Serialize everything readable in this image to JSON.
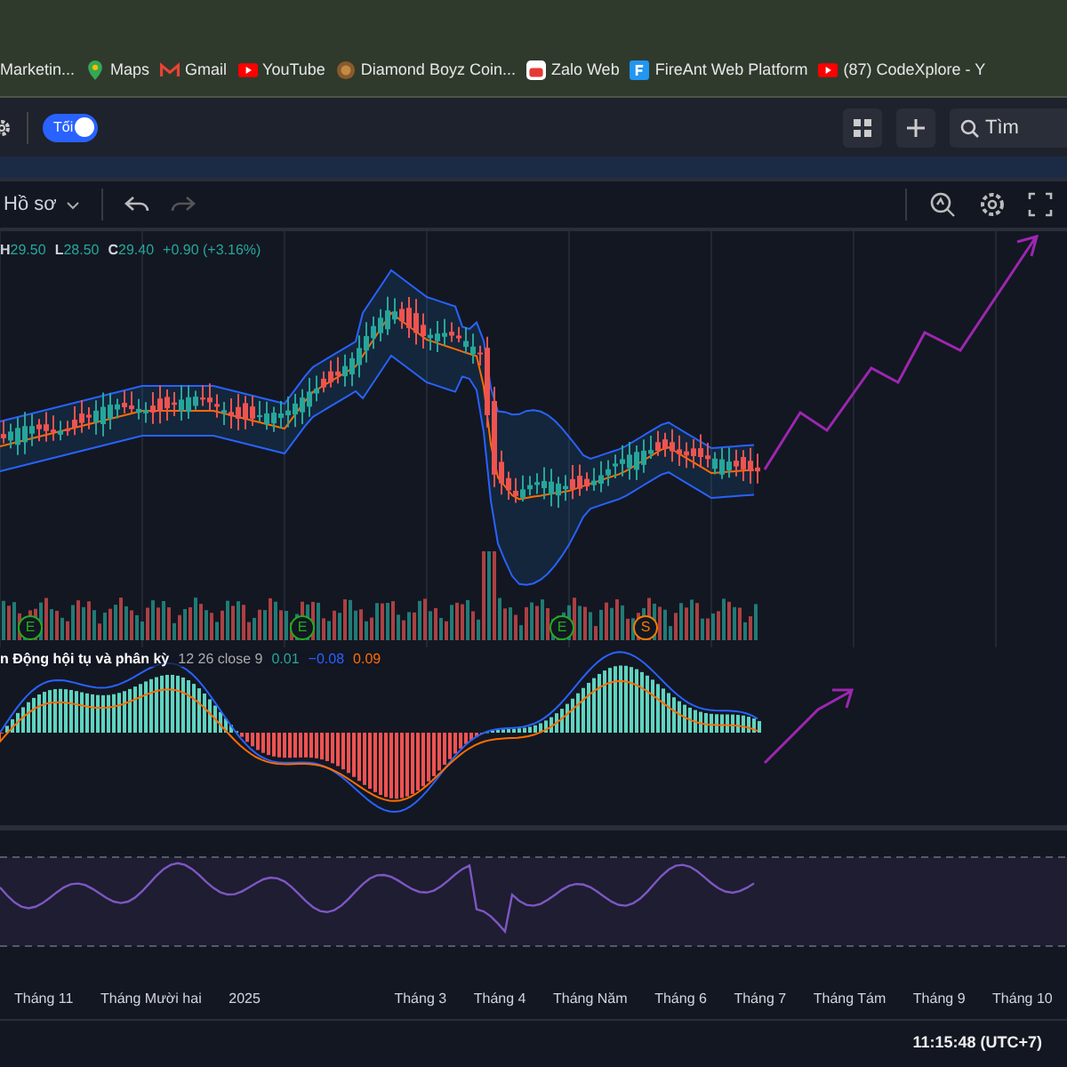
{
  "bookmarks": [
    {
      "label": "Marketin...",
      "kind": "plain"
    },
    {
      "label": "Maps",
      "kind": "pin"
    },
    {
      "label": "Gmail",
      "kind": "mail"
    },
    {
      "label": "YouTube",
      "kind": "play"
    },
    {
      "label": "Diamond Boyz Coin...",
      "kind": "coin"
    },
    {
      "label": "Zalo Web",
      "kind": "chat"
    },
    {
      "label": "FireAnt Web Platform",
      "kind": "letter"
    },
    {
      "label": "(87) CodeXplore - Y",
      "kind": "play"
    }
  ],
  "toolbar": {
    "theme_toggle": {
      "label": "Tối",
      "on": true
    },
    "search": {
      "placeholder": "Tìm"
    }
  },
  "chart_toolbar": {
    "profile": "Hồ sơ"
  },
  "legend": [
    {
      "key": "H",
      "value": "29.50"
    },
    {
      "key": "L",
      "value": "28.50"
    },
    {
      "key": "C",
      "value": "29.40"
    },
    {
      "value": "+0.90 (+3.16%)"
    }
  ],
  "events": [
    {
      "letter": "E",
      "kind": "earnings"
    },
    {
      "letter": "E",
      "kind": "earnings"
    },
    {
      "letter": "E",
      "kind": "earnings"
    },
    {
      "letter": "S",
      "kind": "split"
    }
  ],
  "macd_legend": {
    "title": "n Động hội tụ và phân kỳ",
    "params": "12 26 close 9",
    "values": [
      {
        "text": "0.01",
        "color": "#26a69a"
      },
      {
        "text": "−0.08",
        "color": "#2962ff"
      },
      {
        "text": "0.09",
        "color": "#ff6d00"
      }
    ]
  },
  "time_axis": [
    "Tháng 11",
    "Tháng Mười hai",
    "2025",
    "Tháng 3",
    "Tháng 4",
    "Tháng Năm",
    "Tháng 6",
    "Tháng 7",
    "Tháng Tám",
    "Tháng 9",
    "Tháng 10"
  ],
  "status_bar": {
    "time": "11:15:48 (UTC+7)"
  }
}
